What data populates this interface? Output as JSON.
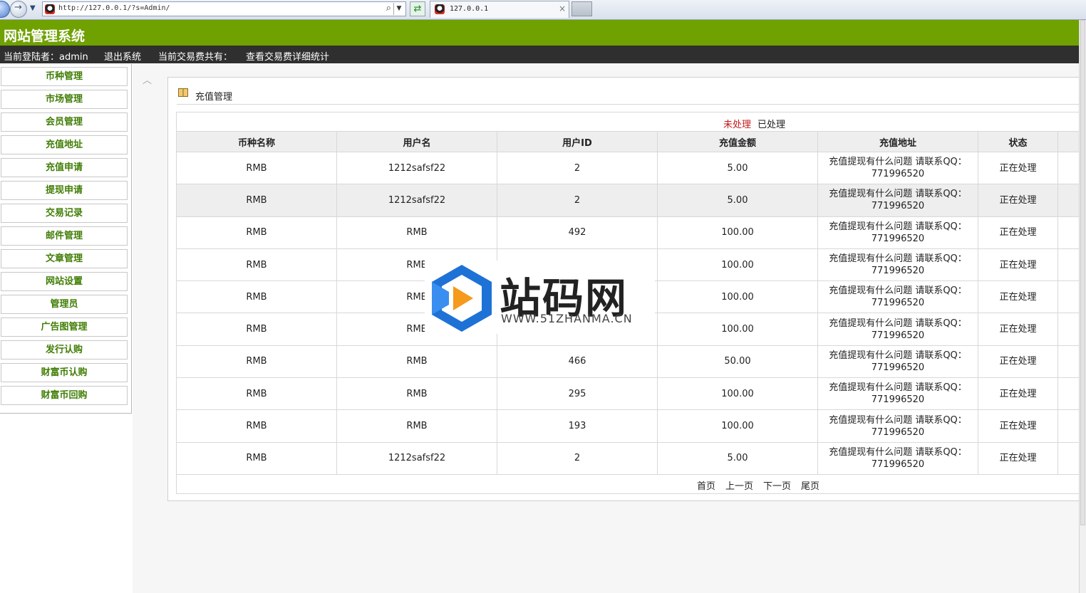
{
  "browser": {
    "url": "http://127.0.0.1/?s=Admin/",
    "tab_title": "127.0.0.1",
    "tab_close": "×"
  },
  "header": {
    "site_title": "网站管理系统",
    "current_user": "当前登陆者：admin",
    "logout": "退出系统",
    "fee_total": "当前交易费共有：",
    "fee_detail": "查看交易费详细统计"
  },
  "sidebar": {
    "items": [
      {
        "label": "币种管理"
      },
      {
        "label": "市场管理"
      },
      {
        "label": "会员管理"
      },
      {
        "label": "充值地址"
      },
      {
        "label": "充值申请"
      },
      {
        "label": "提现申请"
      },
      {
        "label": "交易记录"
      },
      {
        "label": "邮件管理"
      },
      {
        "label": "文章管理"
      },
      {
        "label": "网站设置"
      },
      {
        "label": "管理员"
      },
      {
        "label": "广告图管理"
      },
      {
        "label": "发行认购"
      },
      {
        "label": "财富币认购"
      },
      {
        "label": "财富币回购"
      }
    ],
    "collapse_arrow": "︿"
  },
  "panel": {
    "title": "充值管理",
    "filter_pending": "未处理",
    "filter_done": "已处理"
  },
  "table": {
    "columns": [
      "币种名称",
      "用户名",
      "用户ID",
      "充值金额",
      "充值地址",
      "状态"
    ],
    "rows": [
      {
        "coin": "RMB",
        "user": "1212safsf22",
        "uid": "2",
        "amount": "5.00",
        "addr": "充值提现有什么问题 请联系QQ：771996520",
        "status": "正在处理"
      },
      {
        "coin": "RMB",
        "user": "1212safsf22",
        "uid": "2",
        "amount": "5.00",
        "addr": "充值提现有什么问题 请联系QQ：771996520",
        "status": "正在处理"
      },
      {
        "coin": "RMB",
        "user": "RMB",
        "uid": "492",
        "amount": "100.00",
        "addr": "充值提现有什么问题 请联系QQ：771996520",
        "status": "正在处理"
      },
      {
        "coin": "RMB",
        "user": "RMB",
        "uid": "",
        "amount": "100.00",
        "addr": "充值提现有什么问题 请联系QQ：771996520",
        "status": "正在处理"
      },
      {
        "coin": "RMB",
        "user": "RMB",
        "uid": "",
        "amount": "100.00",
        "addr": "充值提现有什么问题 请联系QQ：771996520",
        "status": "正在处理"
      },
      {
        "coin": "RMB",
        "user": "RMB",
        "uid": "",
        "amount": "100.00",
        "addr": "充值提现有什么问题 请联系QQ：771996520",
        "status": "正在处理"
      },
      {
        "coin": "RMB",
        "user": "RMB",
        "uid": "466",
        "amount": "50.00",
        "addr": "充值提现有什么问题 请联系QQ：771996520",
        "status": "正在处理"
      },
      {
        "coin": "RMB",
        "user": "RMB",
        "uid": "295",
        "amount": "100.00",
        "addr": "充值提现有什么问题 请联系QQ：771996520",
        "status": "正在处理"
      },
      {
        "coin": "RMB",
        "user": "RMB",
        "uid": "193",
        "amount": "100.00",
        "addr": "充值提现有什么问题 请联系QQ：771996520",
        "status": "正在处理"
      },
      {
        "coin": "RMB",
        "user": "1212safsf22",
        "uid": "2",
        "amount": "5.00",
        "addr": "充值提现有什么问题 请联系QQ：771996520",
        "status": "正在处理"
      }
    ]
  },
  "pager": {
    "first": "首页",
    "prev": "上一页",
    "next": "下一页",
    "last": "尾页"
  },
  "watermark": {
    "title": "站码网",
    "url": "WWW.51ZHANMA.CN"
  },
  "colors": {
    "header_green": "#6fa100",
    "sidebar_text": "#417e06",
    "pending_red": "#c21919",
    "userbar_bg": "#2f2f2f"
  }
}
